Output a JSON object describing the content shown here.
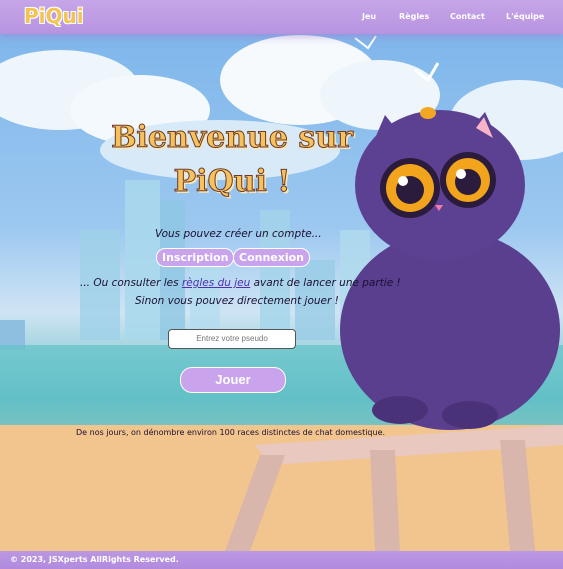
{
  "header": {
    "logo": "PiQui",
    "nav": [
      "Jeu",
      "Règles",
      "Contact",
      "L'équipe"
    ]
  },
  "main": {
    "title_line1": "Bienvenue sur",
    "title_line2": "PiQui !",
    "create_text": "Vous pouvez créer un compte...",
    "inscription_label": "Inscription",
    "connexion_label": "Connexion",
    "rules_prefix": "... Ou consulter les",
    "rules_link": "règles du jeu",
    "rules_suffix": "avant de lancer une partie !",
    "play_direct": "Sinon vous pouvez directement jouer !",
    "pseudo_placeholder": "Entrez votre pseudo",
    "play_button": "Jouer",
    "fact": "De nos jours, on dénombre environ 100 races distinctes de chat domestique."
  },
  "footer": {
    "copyright": "© 2023, JSXperts AllRights Reserved."
  },
  "colors": {
    "header": "#c6a5e8",
    "accent": "#c9a3ec",
    "title": "#f6c25d",
    "logo": "#f2c454"
  }
}
